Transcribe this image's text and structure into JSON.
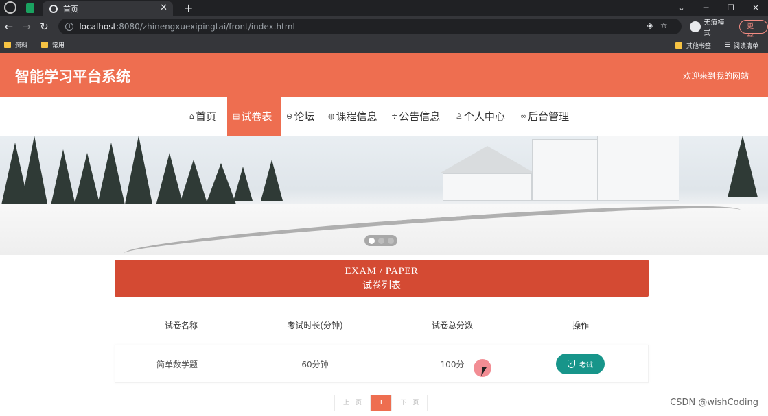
{
  "browser": {
    "tab_title": "首页",
    "url_host": "localhost",
    "url_rest": ":8080/zhinengxuexipingtai/front/index.html",
    "incognito_label": "无痕模式",
    "update_label": "更新",
    "bookmarks": [
      "资料",
      "常用"
    ],
    "bookmarks_right": [
      "其他书签",
      "阅读清单"
    ]
  },
  "site": {
    "title": "智能学习平台系统",
    "welcome": "欢迎来到我的网站",
    "nav": [
      {
        "label": "首页",
        "icon": "home-icon"
      },
      {
        "label": "试卷表",
        "icon": "paper-icon"
      },
      {
        "label": "论坛",
        "icon": "forum-icon"
      },
      {
        "label": "课程信息",
        "icon": "course-icon"
      },
      {
        "label": "公告信息",
        "icon": "notice-icon"
      },
      {
        "label": "个人中心",
        "icon": "user-icon"
      },
      {
        "label": "后台管理",
        "icon": "link-icon"
      }
    ],
    "active_nav": "试卷表"
  },
  "section": {
    "title_en": "EXAM / PAPER",
    "title_zh": "试卷列表"
  },
  "table": {
    "headers": [
      "试卷名称",
      "考试时长(分钟)",
      "试卷总分数",
      "操作"
    ],
    "rows": [
      {
        "name": "简单数学题",
        "duration": "60分钟",
        "score": "100分",
        "action": "考试"
      }
    ]
  },
  "pagination": {
    "prev": "上一页",
    "current": "1",
    "next": "下一页"
  },
  "watermark": "CSDN @wishCoding",
  "colors": {
    "header": "#ee6e50",
    "section_banner": "#d44a33",
    "exam_button": "#17958a"
  }
}
